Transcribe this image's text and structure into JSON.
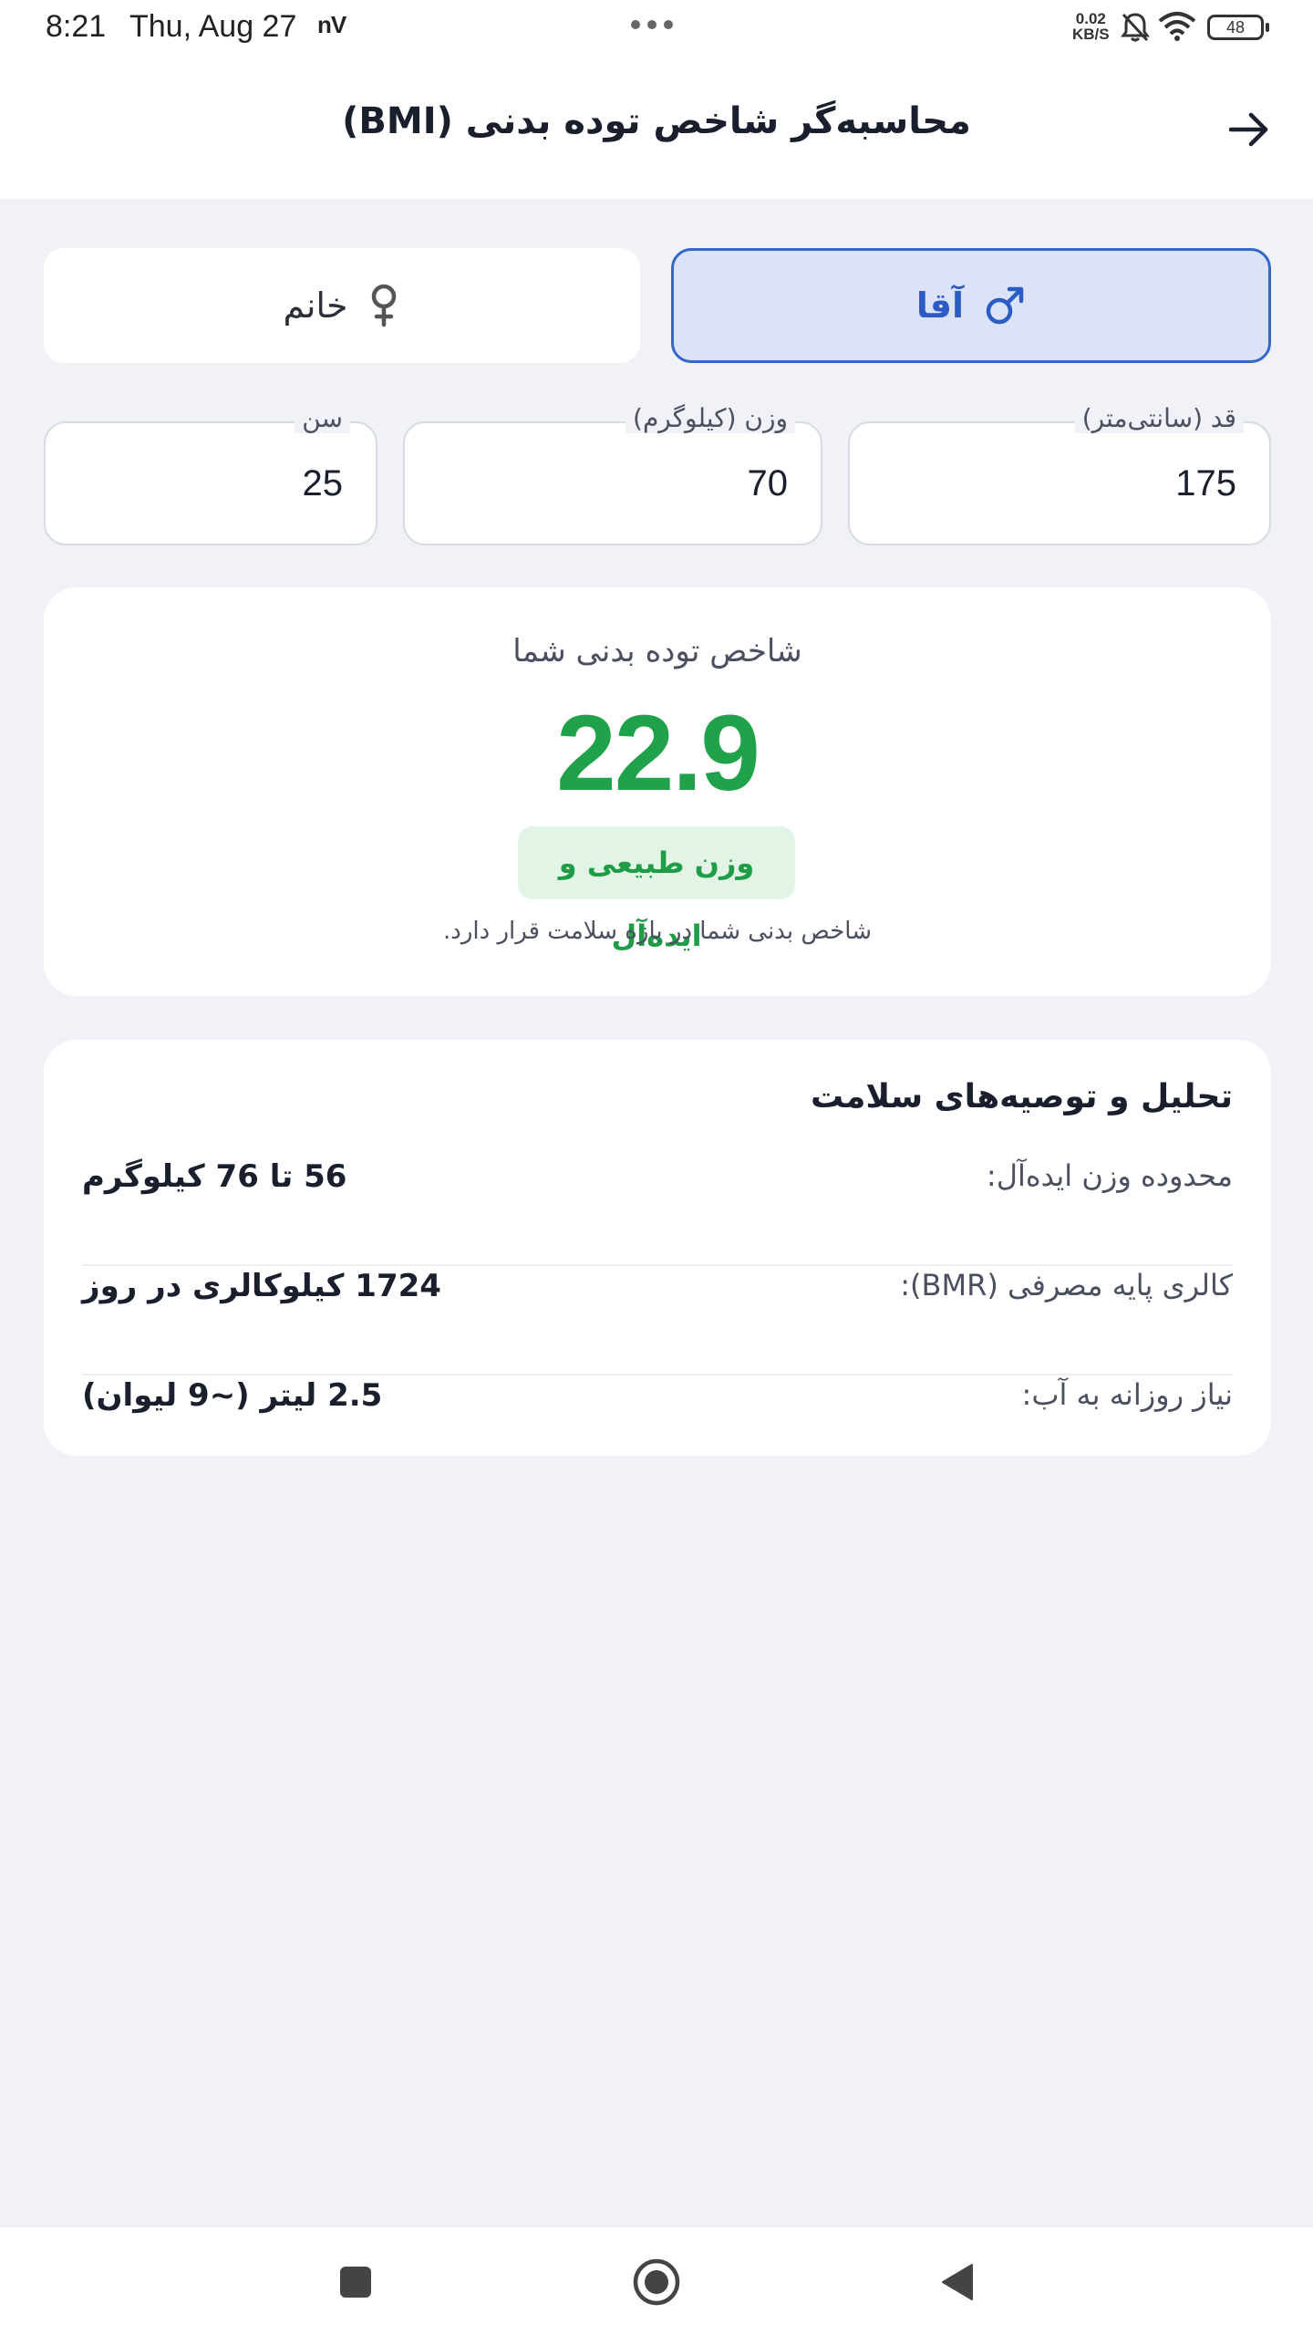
{
  "status_bar": {
    "time": "8:21",
    "date": "Thu, Aug 27",
    "carrier_icon": "nV",
    "net_speed_value": "0.02",
    "net_speed_unit": "KB/S",
    "battery": "48"
  },
  "app_bar": {
    "title": "محاسبه‌گر شاخص توده بدنی (BMI)"
  },
  "gender": {
    "female_label": "خانم",
    "male_label": "آقا",
    "selected": "male"
  },
  "inputs": {
    "height": {
      "label": "قد (سانتی‌متر)",
      "value": "175"
    },
    "weight": {
      "label": "وزن (کیلوگرم)",
      "value": "70"
    },
    "age": {
      "label": "سن",
      "value": "25"
    }
  },
  "result": {
    "title": "شاخص توده بدنی شما",
    "value": "22.9",
    "badge": "وزن طبیعی و ایده‌آل",
    "note": "شاخص بدنی شما در بازه سلامت قرار دارد.",
    "color": "#1fa24a"
  },
  "analysis": {
    "title": "تحلیل و توصیه‌های سلامت",
    "rows": [
      {
        "label": "محدوده وزن ایده‌آل:",
        "value": "56 تا 76 کیلوگرم"
      },
      {
        "label": "کالری پایه مصرفی (BMR):",
        "value": "1724 کیلوکالری در روز"
      },
      {
        "label": "نیاز روزانه به آب:",
        "value": "2.5 لیتر (~9 لیوان)"
      }
    ]
  },
  "colors": {
    "accent": "#3566c9",
    "success": "#1fa24a",
    "background": "#f0f2f7"
  }
}
